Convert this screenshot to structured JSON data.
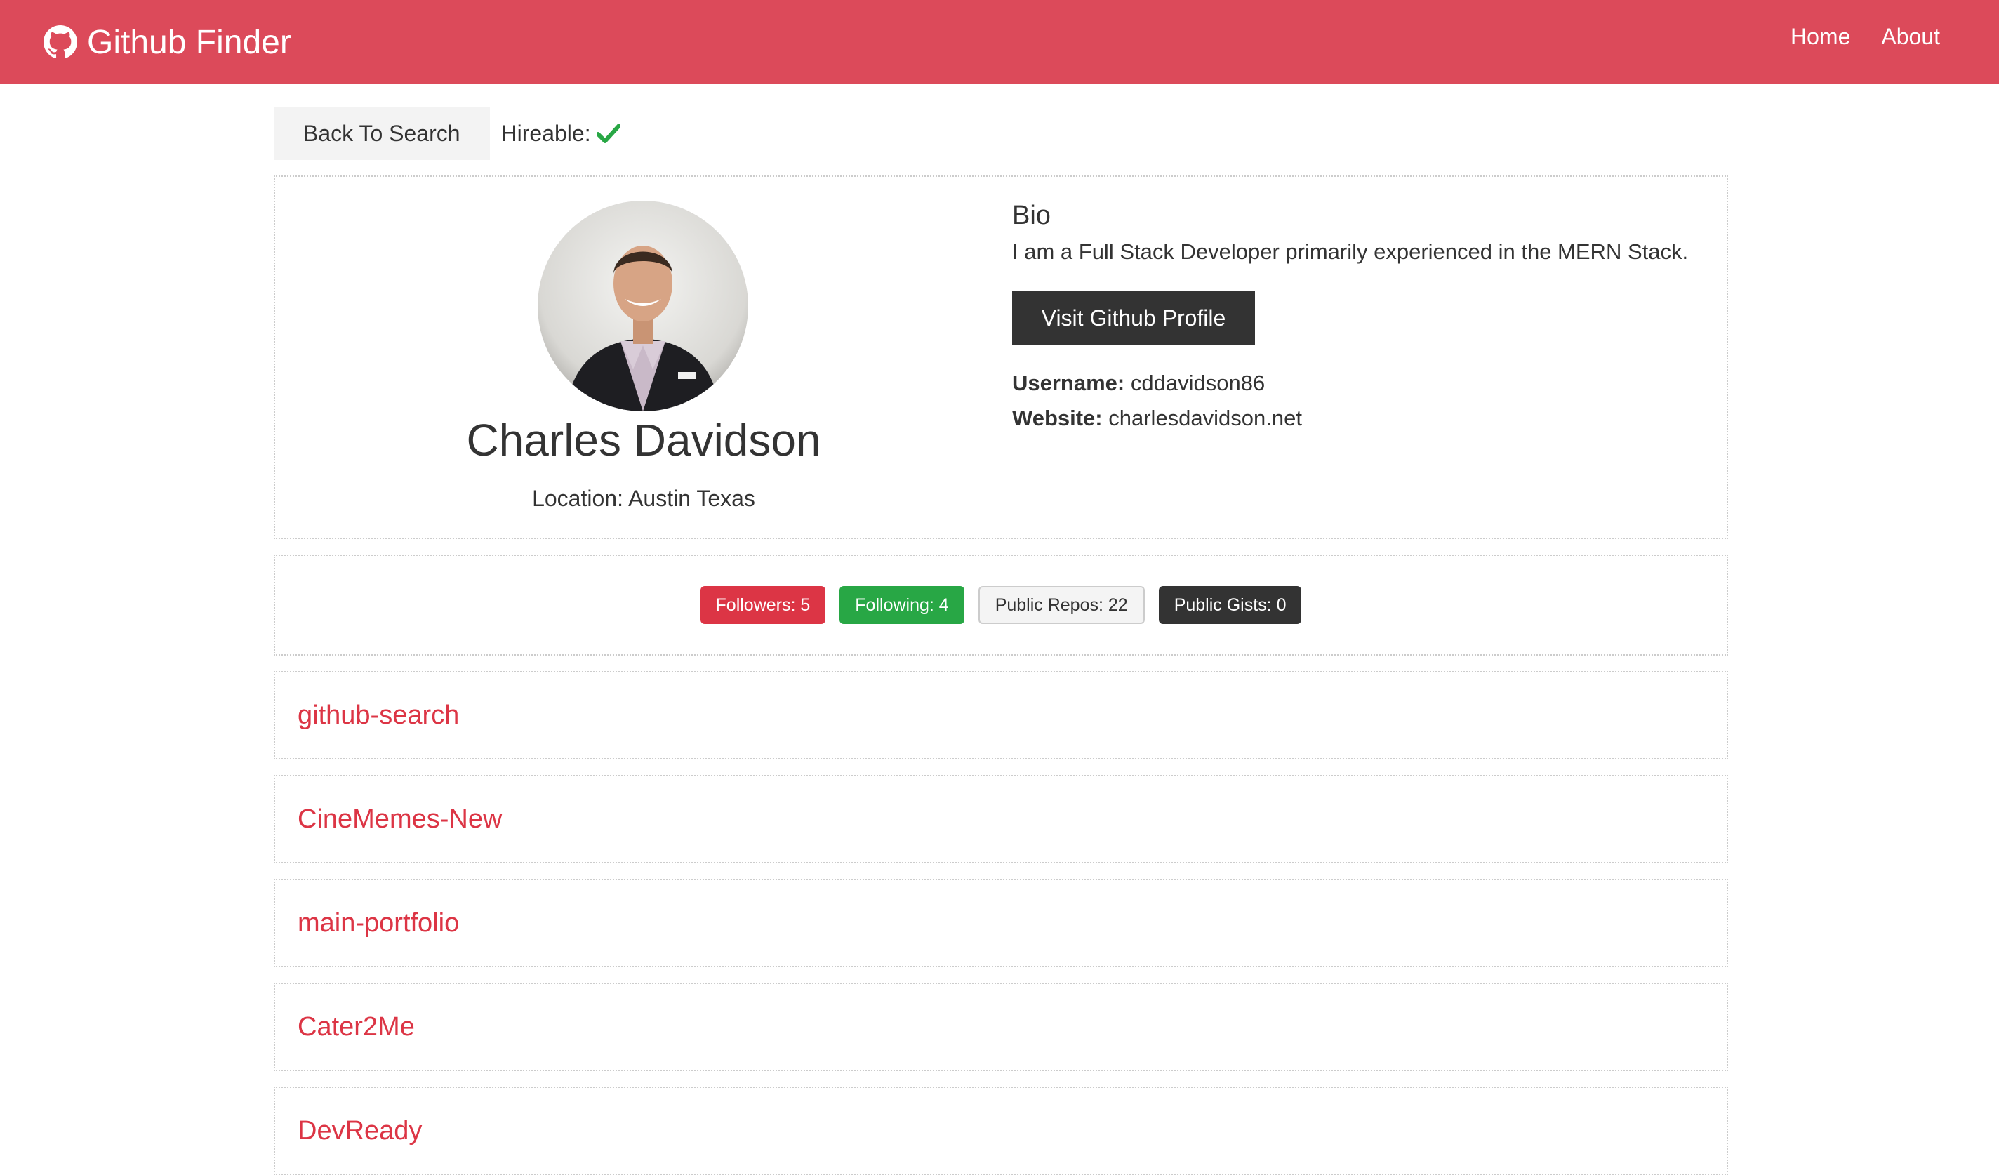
{
  "navbar": {
    "brand_icon": "github-icon",
    "title": "Github Finder",
    "links": [
      "Home",
      "About"
    ]
  },
  "actions": {
    "back_label": "Back To Search",
    "hireable_label": "Hireable:",
    "hireable_icon": "check-icon",
    "hireable_value": true
  },
  "profile": {
    "name": "Charles Davidson",
    "location": "Location: Austin Texas",
    "bio_title": "Bio",
    "bio": "I am a Full Stack Developer primarily experienced in the MERN Stack.",
    "visit_label": "Visit Github Profile",
    "username_label": "Username:",
    "username": "cddavidson86",
    "website_label": "Website:",
    "website": "charlesdavidson.net"
  },
  "stats": {
    "followers": "Followers: 5",
    "following": "Following: 4",
    "public_repos": "Public Repos: 22",
    "public_gists": "Public Gists: 0"
  },
  "repos": [
    "github-search",
    "CineMemes-New",
    "main-portfolio",
    "Cater2Me",
    "DevReady"
  ],
  "colors": {
    "navbar": "#dc4a5a",
    "primary": "#dc3545",
    "success": "#28a745",
    "dark": "#333333",
    "light": "#f4f4f4"
  }
}
